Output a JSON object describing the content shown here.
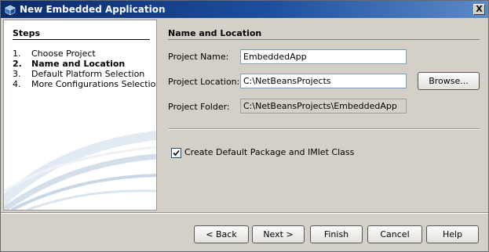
{
  "window": {
    "title": "New Embedded Application",
    "close_label": "X",
    "icon": "netbeans-cube-icon"
  },
  "steps": {
    "heading": "Steps",
    "items": [
      {
        "num": "1.",
        "label": "Choose Project",
        "current": false
      },
      {
        "num": "2.",
        "label": "Name and Location",
        "current": true
      },
      {
        "num": "3.",
        "label": "Default Platform Selection",
        "current": false
      },
      {
        "num": "4.",
        "label": "More Configurations Selection",
        "current": false
      }
    ]
  },
  "panel": {
    "heading": "Name and Location",
    "project_name_label": "Project Name:",
    "project_name_value": "EmbeddedApp",
    "project_location_label": "Project Location:",
    "project_location_value": "C:\\NetBeansProjects",
    "browse_label": "Browse...",
    "project_folder_label": "Project Folder:",
    "project_folder_value": "C:\\NetBeansProjects\\EmbeddedApp",
    "checkbox_label": "Create Default Package and IMlet Class",
    "checkbox_checked": true
  },
  "buttons": {
    "back": "< Back",
    "next": "Next >",
    "finish": "Finish",
    "cancel": "Cancel",
    "help": "Help"
  }
}
